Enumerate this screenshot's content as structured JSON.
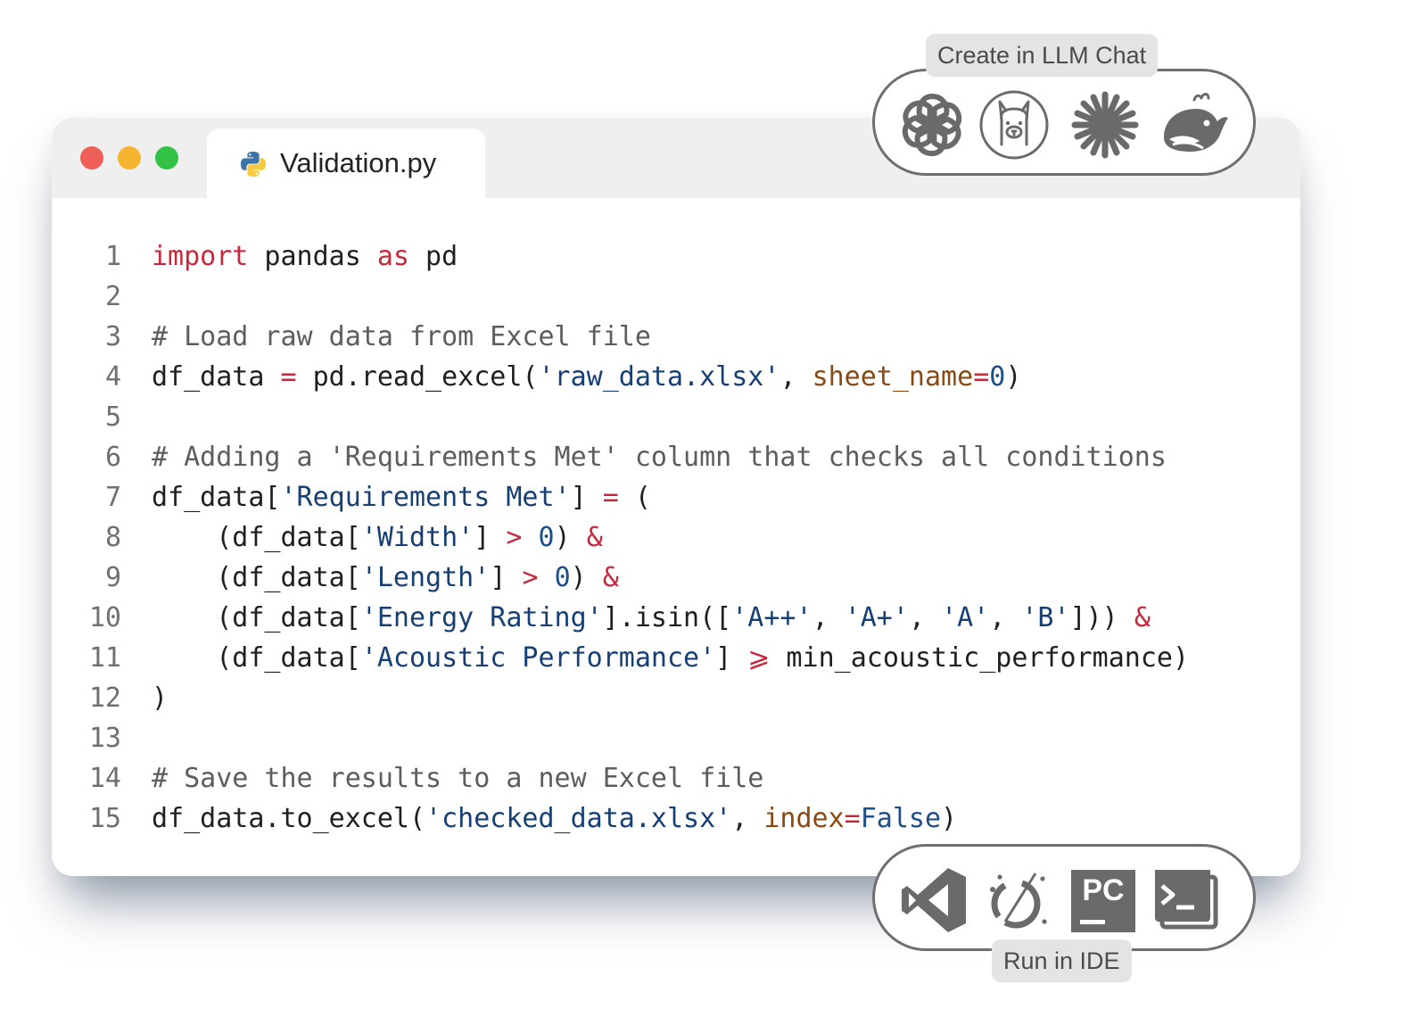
{
  "window": {
    "traffic_lights": [
      "#ed5f57",
      "#f6b52f",
      "#33c146"
    ],
    "tab": {
      "icon": "python-icon",
      "title": "Validation.py"
    }
  },
  "code": {
    "lines": [
      {
        "n": "1",
        "segments": [
          {
            "t": "import",
            "c": "kw"
          },
          {
            "t": " pandas ",
            "c": ""
          },
          {
            "t": "as",
            "c": "kw"
          },
          {
            "t": " pd",
            "c": ""
          }
        ]
      },
      {
        "n": "2",
        "segments": []
      },
      {
        "n": "3",
        "segments": [
          {
            "t": "# Load raw data from Excel file",
            "c": "cm"
          }
        ]
      },
      {
        "n": "4",
        "segments": [
          {
            "t": "df_data ",
            "c": ""
          },
          {
            "t": "=",
            "c": "op"
          },
          {
            "t": " pd.read_excel(",
            "c": ""
          },
          {
            "t": "'raw_data.xlsx'",
            "c": "str"
          },
          {
            "t": ", ",
            "c": ""
          },
          {
            "t": "sheet_name",
            "c": "par"
          },
          {
            "t": "=",
            "c": "op"
          },
          {
            "t": "0",
            "c": "num"
          },
          {
            "t": ")",
            "c": ""
          }
        ]
      },
      {
        "n": "5",
        "segments": []
      },
      {
        "n": "6",
        "segments": [
          {
            "t": "# Adding a 'Requirements Met' column that checks all conditions",
            "c": "cm"
          }
        ]
      },
      {
        "n": "7",
        "segments": [
          {
            "t": "df_data[",
            "c": ""
          },
          {
            "t": "'Requirements Met'",
            "c": "str"
          },
          {
            "t": "] ",
            "c": ""
          },
          {
            "t": "=",
            "c": "op"
          },
          {
            "t": " (",
            "c": ""
          }
        ]
      },
      {
        "n": "8",
        "segments": [
          {
            "t": "    (df_data[",
            "c": ""
          },
          {
            "t": "'Width'",
            "c": "str"
          },
          {
            "t": "] ",
            "c": ""
          },
          {
            "t": ">",
            "c": "op"
          },
          {
            "t": " ",
            "c": ""
          },
          {
            "t": "0",
            "c": "num"
          },
          {
            "t": ") ",
            "c": ""
          },
          {
            "t": "&",
            "c": "op"
          }
        ]
      },
      {
        "n": "9",
        "segments": [
          {
            "t": "    (df_data[",
            "c": ""
          },
          {
            "t": "'Length'",
            "c": "str"
          },
          {
            "t": "] ",
            "c": ""
          },
          {
            "t": ">",
            "c": "op"
          },
          {
            "t": " ",
            "c": ""
          },
          {
            "t": "0",
            "c": "num"
          },
          {
            "t": ") ",
            "c": ""
          },
          {
            "t": "&",
            "c": "op"
          }
        ]
      },
      {
        "n": "10",
        "segments": [
          {
            "t": "    (df_data[",
            "c": ""
          },
          {
            "t": "'Energy Rating'",
            "c": "str"
          },
          {
            "t": "].isin([",
            "c": ""
          },
          {
            "t": "'A++'",
            "c": "str"
          },
          {
            "t": ", ",
            "c": ""
          },
          {
            "t": "'A+'",
            "c": "str"
          },
          {
            "t": ", ",
            "c": ""
          },
          {
            "t": "'A'",
            "c": "str"
          },
          {
            "t": ", ",
            "c": ""
          },
          {
            "t": "'B'",
            "c": "str"
          },
          {
            "t": "])) ",
            "c": ""
          },
          {
            "t": "&",
            "c": "op"
          }
        ]
      },
      {
        "n": "11",
        "segments": [
          {
            "t": "    (df_data[",
            "c": ""
          },
          {
            "t": "'Acoustic Performance'",
            "c": "str"
          },
          {
            "t": "] ",
            "c": ""
          },
          {
            "t": "⩾",
            "c": "op"
          },
          {
            "t": " min_acoustic_performance)",
            "c": ""
          }
        ]
      },
      {
        "n": "12",
        "segments": [
          {
            "t": ")",
            "c": ""
          }
        ]
      },
      {
        "n": "13",
        "segments": []
      },
      {
        "n": "14",
        "segments": [
          {
            "t": "# Save the results to a new Excel file",
            "c": "cm"
          }
        ]
      },
      {
        "n": "15",
        "segments": [
          {
            "t": "df_data.to_excel(",
            "c": ""
          },
          {
            "t": "'checked_data.xlsx'",
            "c": "str"
          },
          {
            "t": ", ",
            "c": ""
          },
          {
            "t": "index",
            "c": "par"
          },
          {
            "t": "=",
            "c": "op"
          },
          {
            "t": "False",
            "c": "bool"
          },
          {
            "t": ")",
            "c": ""
          }
        ]
      }
    ]
  },
  "llm_chat": {
    "label": "Create in LLM Chat",
    "icons": [
      "openai-icon",
      "llama-icon",
      "claude-icon",
      "deepseek-icon"
    ]
  },
  "ide": {
    "label": "Run in IDE",
    "icons": [
      "vscode-icon",
      "eclipse-icon",
      "pycharm-icon",
      "terminal-icon"
    ],
    "pycharm_text": "PC"
  }
}
